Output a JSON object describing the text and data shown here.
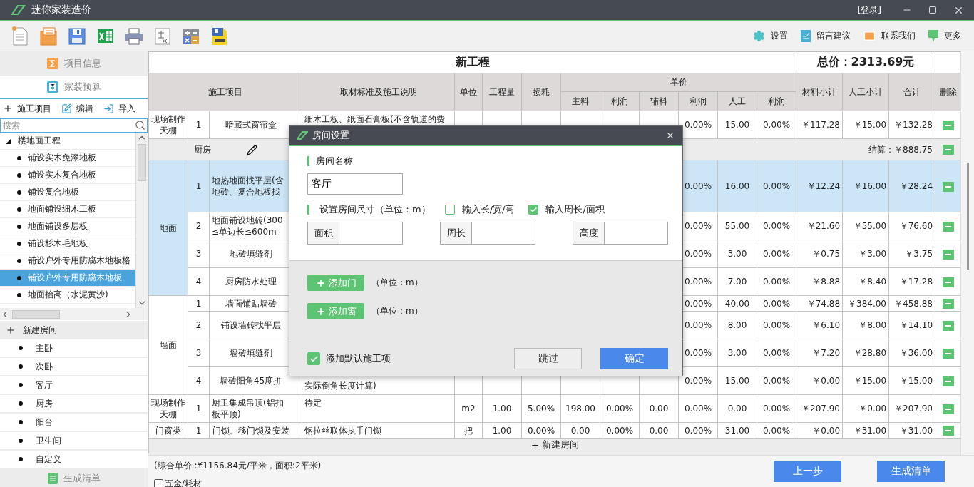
{
  "window": {
    "title": "迷你家装造价",
    "login": "[登录]"
  },
  "toolbar": {
    "links": [
      {
        "kind": "settings",
        "label": "设置"
      },
      {
        "kind": "feedback",
        "label": "留言建议"
      },
      {
        "kind": "contact",
        "label": "联系我们"
      },
      {
        "kind": "more",
        "label": "更多"
      }
    ]
  },
  "sidebar": {
    "tabs": [
      {
        "kind": "info",
        "label": "项目信息",
        "selected": false
      },
      {
        "kind": "budget",
        "label": "家装预算",
        "selected": true
      }
    ],
    "actions": [
      {
        "kind": "add",
        "label": "施工项目"
      },
      {
        "kind": "edit",
        "label": "编辑"
      },
      {
        "kind": "import",
        "label": "导入"
      }
    ],
    "search": {
      "placeholder": "搜索"
    },
    "tree": [
      {
        "label": "楼地面工程",
        "expanded": true,
        "children": [
          {
            "label": "铺设实木免漆地板",
            "selected": false
          },
          {
            "label": "铺设实木复合地板",
            "selected": false
          },
          {
            "label": "铺设复合地板",
            "selected": false
          },
          {
            "label": "地面铺设细木工板",
            "selected": false
          },
          {
            "label": "地面铺设多层板",
            "selected": false
          },
          {
            "label": "铺设杉木毛地板",
            "selected": false
          },
          {
            "label": "铺设户外专用防腐木地板格",
            "selected": false
          },
          {
            "label": "铺设户外专用防腐木地板",
            "selected": true
          },
          {
            "label": "地面抬高（水泥黄沙)",
            "selected": false
          }
        ]
      }
    ],
    "rooms": {
      "label": "新建房间",
      "items": [
        "主卧",
        "次卧",
        "客厅",
        "厨房",
        "阳台",
        "卫生间",
        "自定义"
      ]
    },
    "bottom_tab": {
      "label": "生成清单"
    }
  },
  "table": {
    "title": "新工程",
    "total": "总价：2313.69元",
    "header": {
      "before": [
        "施工项目",
        "取材标准及施工说明",
        "单位",
        "工程量",
        "损耗"
      ],
      "price_group": "单价",
      "price_columns": [
        "主料",
        "利润",
        "辅料",
        "利润",
        "人工",
        "利润"
      ],
      "after": [
        "材料小计",
        "人工小计",
        "合计",
        "删除"
      ]
    },
    "blocks": [
      {
        "kind": "group",
        "name": "现场制作天棚",
        "selected": false,
        "rows": [
          {
            "index": "1",
            "item": "暗藏式窗帘盒",
            "desc": "细木工板、纸面石膏板(不含轨道的费",
            "profit_2": "0.00%",
            "labor": "15.00",
            "profit_3": "0.00%",
            "material_total": "￥117.28",
            "labor_total": "￥15.00",
            "total": "￥132.28",
            "selected": false
          }
        ]
      },
      {
        "kind": "section",
        "name": "厨房",
        "subtotal": "结算：￥888.75"
      },
      {
        "kind": "group",
        "name": "地面",
        "selected": true,
        "rows": [
          {
            "index": "1",
            "item": "地热地面找平层(含地砖、复合地板找",
            "profit_2": "0.00%",
            "labor": "16.00",
            "profit_3": "0.00%",
            "material_total": "￥12.24",
            "labor_total": "￥16.00",
            "total": "￥28.24",
            "selected": true
          },
          {
            "index": "2",
            "item": "地面铺设地砖(300≤单边长≤600m",
            "profit_2": "0.00%",
            "labor": "55.00",
            "profit_3": "0.00%",
            "material_total": "￥21.60",
            "labor_total": "￥55.00",
            "total": "￥76.60",
            "selected": false
          },
          {
            "index": "3",
            "item": "地砖填缝剂",
            "profit_2": "0.00%",
            "labor": "3.00",
            "profit_3": "0.00%",
            "material_total": "￥0.75",
            "labor_total": "￥3.00",
            "total": "￥3.75",
            "selected": false
          },
          {
            "index": "4",
            "item": "厨房防水处理",
            "profit_2": "0.00%",
            "labor": "7.00",
            "profit_3": "0.00%",
            "material_total": "￥8.88",
            "labor_total": "￥8.40",
            "total": "￥17.28",
            "selected": false
          }
        ]
      },
      {
        "kind": "group",
        "name": "墙面",
        "selected": false,
        "rows": [
          {
            "index": "1",
            "item": "墙面铺贴墙砖",
            "profit_2": "0.00%",
            "labor": "40.00",
            "profit_3": "0.00%",
            "material_total": "￥74.88",
            "labor_total": "￥384.00",
            "total": "￥458.88",
            "selected": false
          },
          {
            "index": "2",
            "item": "铺设墙砖找平层",
            "profit_2": "0.00%",
            "labor": "8.00",
            "profit_3": "0.00%",
            "material_total": "￥6.10",
            "labor_total": "￥8.00",
            "total": "￥14.10",
            "selected": false
          },
          {
            "index": "3",
            "item": "墙砖填缝剂",
            "profit_2": "0.00%",
            "labor": "3.00",
            "profit_3": "0.00%",
            "material_total": "￥7.20",
            "labor_total": "￥28.80",
            "total": "￥36.00",
            "selected": false
          },
          {
            "index": "4",
            "item": "墙砖阳角45度拼",
            "desc": "实际倒角长度计算)",
            "desc_wrapped": true,
            "profit_2": "0.00%",
            "labor": "15.00",
            "profit_3": "0.00%",
            "material_total": "￥0.00",
            "labor_total": "￥15.00",
            "total": "￥15.00",
            "selected": false
          }
        ]
      },
      {
        "kind": "group",
        "name": "现场制作天棚",
        "selected": false,
        "rows": [
          {
            "index": "1",
            "item": "厨卫集成吊顶(铝扣板平顶)",
            "desc": "待定",
            "unit": "m2",
            "qty": "1.00",
            "loss": "5.00%",
            "main": "198.00",
            "profit_1": "0.00%",
            "aux": "0.00",
            "profit_2": "0.00%",
            "labor": "0.00",
            "profit_3": "0.00%",
            "material_total": "￥207.90",
            "labor_total": "￥0.00",
            "total": "￥207.90",
            "selected": false
          }
        ]
      },
      {
        "kind": "group",
        "name": "门窗类",
        "selected": false,
        "rows": [
          {
            "index": "1",
            "item": "门锁、移门锁及安装",
            "desc": "钢拉丝联体执手门锁",
            "unit": "把",
            "qty": "1.00",
            "loss": "0.00%",
            "main": "0.00",
            "profit_1": "0.00%",
            "aux": "0.00",
            "profit_2": "0.00%",
            "labor": "31.00",
            "profit_3": "0.00%",
            "material_total": "￥0.00",
            "labor_total": "￥31.00",
            "total": "￥31.00",
            "selected": false
          }
        ]
      }
    ],
    "add_room": "新建房间"
  },
  "footer": {
    "summary": "(综合单价 :¥1156.84元/平米，面积:2平米)",
    "option": {
      "label": "五金/耗材",
      "checked": false
    },
    "buttons": [
      "上一步",
      "生成清单"
    ]
  },
  "dialog": {
    "title": "房间设置",
    "name_label": "房间名称",
    "name_value": "客厅",
    "size_label": "设置房间尺寸（单位：m）",
    "modes": [
      {
        "label": "输入长/宽/高",
        "checked": false
      },
      {
        "label": "输入周长/面积",
        "checked": true
      }
    ],
    "fields": [
      {
        "label": "面积"
      },
      {
        "label": "周长"
      },
      {
        "label": "高度"
      }
    ],
    "adds": [
      {
        "label": "添加门",
        "unit": "（单位：m）"
      },
      {
        "label": "添加窗",
        "unit": "（单位：m）"
      }
    ],
    "default_items": {
      "label": "添加默认施工项",
      "checked": true
    },
    "buttons": [
      {
        "kind": "secondary",
        "label": "跳过"
      },
      {
        "kind": "primary",
        "label": "确定"
      }
    ]
  }
}
